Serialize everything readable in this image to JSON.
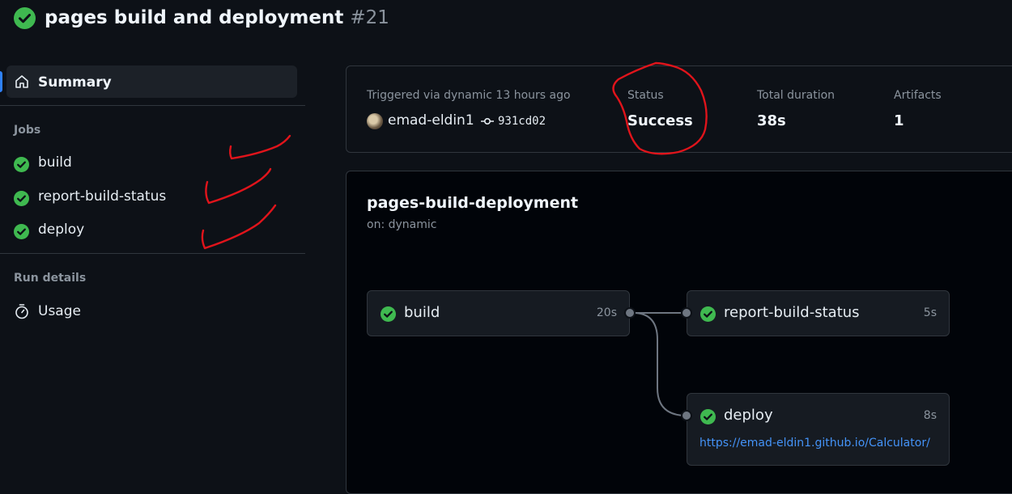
{
  "header": {
    "title": "pages build and deployment",
    "run_number": "#21",
    "status_icon": "check-circle-icon"
  },
  "sidebar": {
    "summary_label": "Summary",
    "jobs_heading": "Jobs",
    "jobs": [
      {
        "label": "build",
        "status": "success"
      },
      {
        "label": "report-build-status",
        "status": "success"
      },
      {
        "label": "deploy",
        "status": "success"
      }
    ],
    "run_details_heading": "Run details",
    "usage_label": "Usage"
  },
  "status_card": {
    "trigger_text": "Triggered via dynamic 13 hours ago",
    "actor": "emad-eldin1",
    "commit_sha": "931cd02",
    "status_label": "Status",
    "status_value": "Success",
    "duration_label": "Total duration",
    "duration_value": "38s",
    "artifacts_label": "Artifacts",
    "artifacts_value": "1"
  },
  "workflow": {
    "name": "pages-build-deployment",
    "trigger": "on: dynamic",
    "nodes": [
      {
        "label": "build",
        "duration": "20s"
      },
      {
        "label": "report-build-status",
        "duration": "5s"
      },
      {
        "label": "deploy",
        "duration": "8s",
        "url": "https://emad-eldin1.github.io/Calculator/"
      }
    ]
  },
  "colors": {
    "success": "#3fb950",
    "accent": "#2f81f7",
    "link": "#4493f8",
    "annotation": "#e0141b"
  }
}
